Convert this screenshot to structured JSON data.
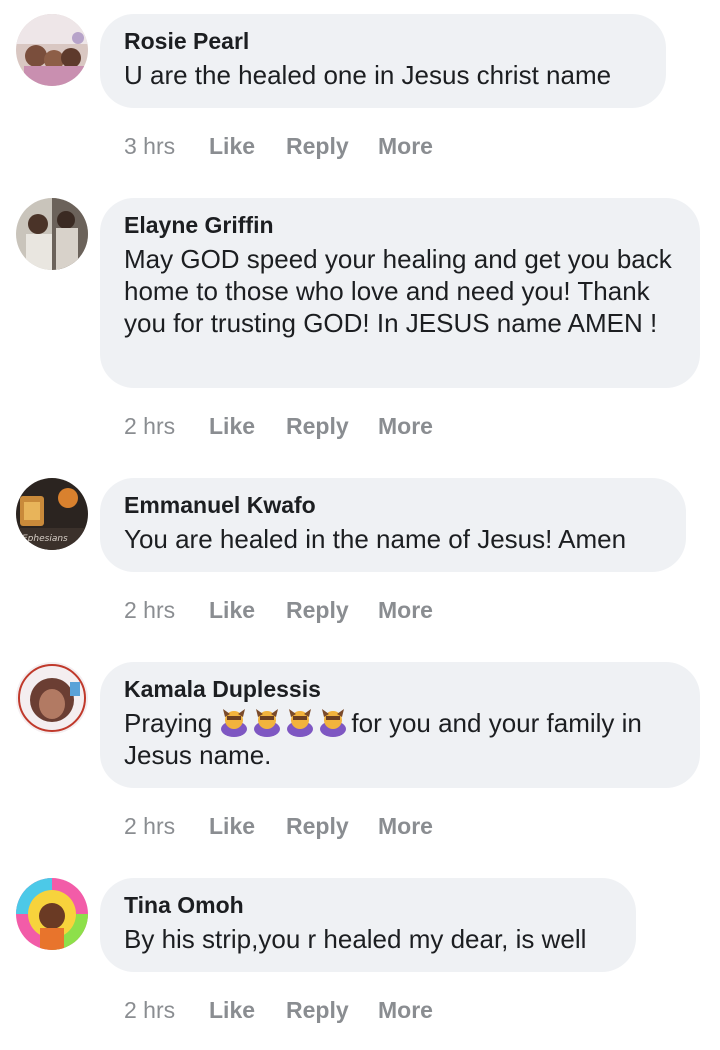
{
  "comments": [
    {
      "author": "Rosie Pearl",
      "text": "U are the healed one in Jesus christ name",
      "time": "3 hrs",
      "like": "Like",
      "reply": "Reply",
      "more": "More"
    },
    {
      "author": "Elayne Griffin",
      "text": "May GOD speed your healing and get you back home to those who love and need you! Thank you for trusting GOD! In JESUS name AMEN !",
      "time": "2 hrs",
      "like": "Like",
      "reply": "Reply",
      "more": "More"
    },
    {
      "author": "Emmanuel Kwafo",
      "text": "You are healed in the name of Jesus! Amen",
      "time": "2 hrs",
      "like": "Like",
      "reply": "Reply",
      "more": "More",
      "avatar_text": "Ephesians"
    },
    {
      "author": "Kamala Duplessis",
      "text_before": "Praying ",
      "emoji": "person-bowing-emoji",
      "emoji_count": 4,
      "text_after": "for you and your family in Jesus name.",
      "time": "2 hrs",
      "like": "Like",
      "reply": "Reply",
      "more": "More"
    },
    {
      "author": "Tina Omoh",
      "text": "By his strip,you r healed my dear, is well",
      "time": "2 hrs",
      "like": "Like",
      "reply": "Reply",
      "more": "More"
    }
  ],
  "colors": {
    "bubble": "#eff1f4",
    "meta_text": "#8a8d91",
    "primary_text": "#1c1e21"
  }
}
